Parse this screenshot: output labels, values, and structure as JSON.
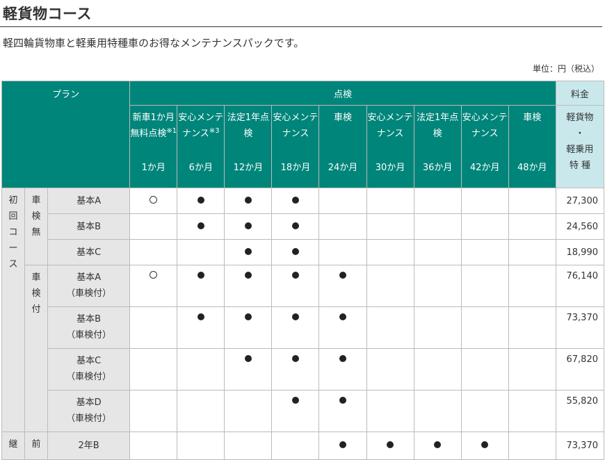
{
  "page": {
    "title": "軽貨物コース",
    "intro": "軽四輪貨物車と軽乗用特種車のお得なメンテナンスパックです。",
    "unit_note": "単位：円（税込）"
  },
  "table": {
    "header": {
      "plan": "プラン",
      "inspection": "点検",
      "fee": "料金",
      "fee_sub": [
        "軽貨物",
        "・",
        "軽乗用",
        "特 種"
      ],
      "columns": [
        {
          "label": "新車1か月無料点検",
          "sup": "※1",
          "month": "1か月"
        },
        {
          "label": "安心メンテナンス",
          "sup": "※3",
          "month": "6か月"
        },
        {
          "label": "法定1年点検",
          "sup": "",
          "month": "12か月"
        },
        {
          "label": "安心メンテナンス",
          "sup": "",
          "month": "18か月"
        },
        {
          "label": "車検",
          "sup": "",
          "month": "24か月"
        },
        {
          "label": "安心メンテナンス",
          "sup": "",
          "month": "30か月"
        },
        {
          "label": "法定1年点検",
          "sup": "",
          "month": "36か月"
        },
        {
          "label": "安心メンテナンス",
          "sup": "",
          "month": "42か月"
        },
        {
          "label": "車検",
          "sup": "",
          "month": "48か月"
        }
      ]
    },
    "groups": {
      "first_course": "初回コース",
      "no_shaken": "車検無",
      "with_shaken": "車検付",
      "continue_course": "継",
      "prev": "前"
    },
    "rows": [
      {
        "plan": "基本A",
        "plan_sub": "",
        "marks": [
          "ring",
          "dot",
          "dot",
          "dot",
          "",
          "",
          "",
          "",
          ""
        ],
        "price": "27,300"
      },
      {
        "plan": "基本B",
        "plan_sub": "",
        "marks": [
          "",
          "dot",
          "dot",
          "dot",
          "",
          "",
          "",
          "",
          ""
        ],
        "price": "24,560"
      },
      {
        "plan": "基本C",
        "plan_sub": "",
        "marks": [
          "",
          "",
          "dot",
          "dot",
          "",
          "",
          "",
          "",
          ""
        ],
        "price": "18,990"
      },
      {
        "plan": "基本A",
        "plan_sub": "（車検付）",
        "marks": [
          "ring",
          "dot",
          "dot",
          "dot",
          "dot",
          "",
          "",
          "",
          ""
        ],
        "price": "76,140"
      },
      {
        "plan": "基本B",
        "plan_sub": "（車検付）",
        "marks": [
          "",
          "dot",
          "dot",
          "dot",
          "dot",
          "",
          "",
          "",
          ""
        ],
        "price": "73,370"
      },
      {
        "plan": "基本C",
        "plan_sub": "（車検付）",
        "marks": [
          "",
          "",
          "dot",
          "dot",
          "dot",
          "",
          "",
          "",
          ""
        ],
        "price": "67,820"
      },
      {
        "plan": "基本D",
        "plan_sub": "（車検付）",
        "marks": [
          "",
          "",
          "",
          "dot",
          "dot",
          "",
          "",
          "",
          ""
        ],
        "price": "55,820"
      },
      {
        "plan": "2年B",
        "plan_sub": "",
        "marks": [
          "",
          "",
          "",
          "",
          "dot",
          "dot",
          "dot",
          "dot",
          ""
        ],
        "price": "73,370"
      }
    ]
  }
}
